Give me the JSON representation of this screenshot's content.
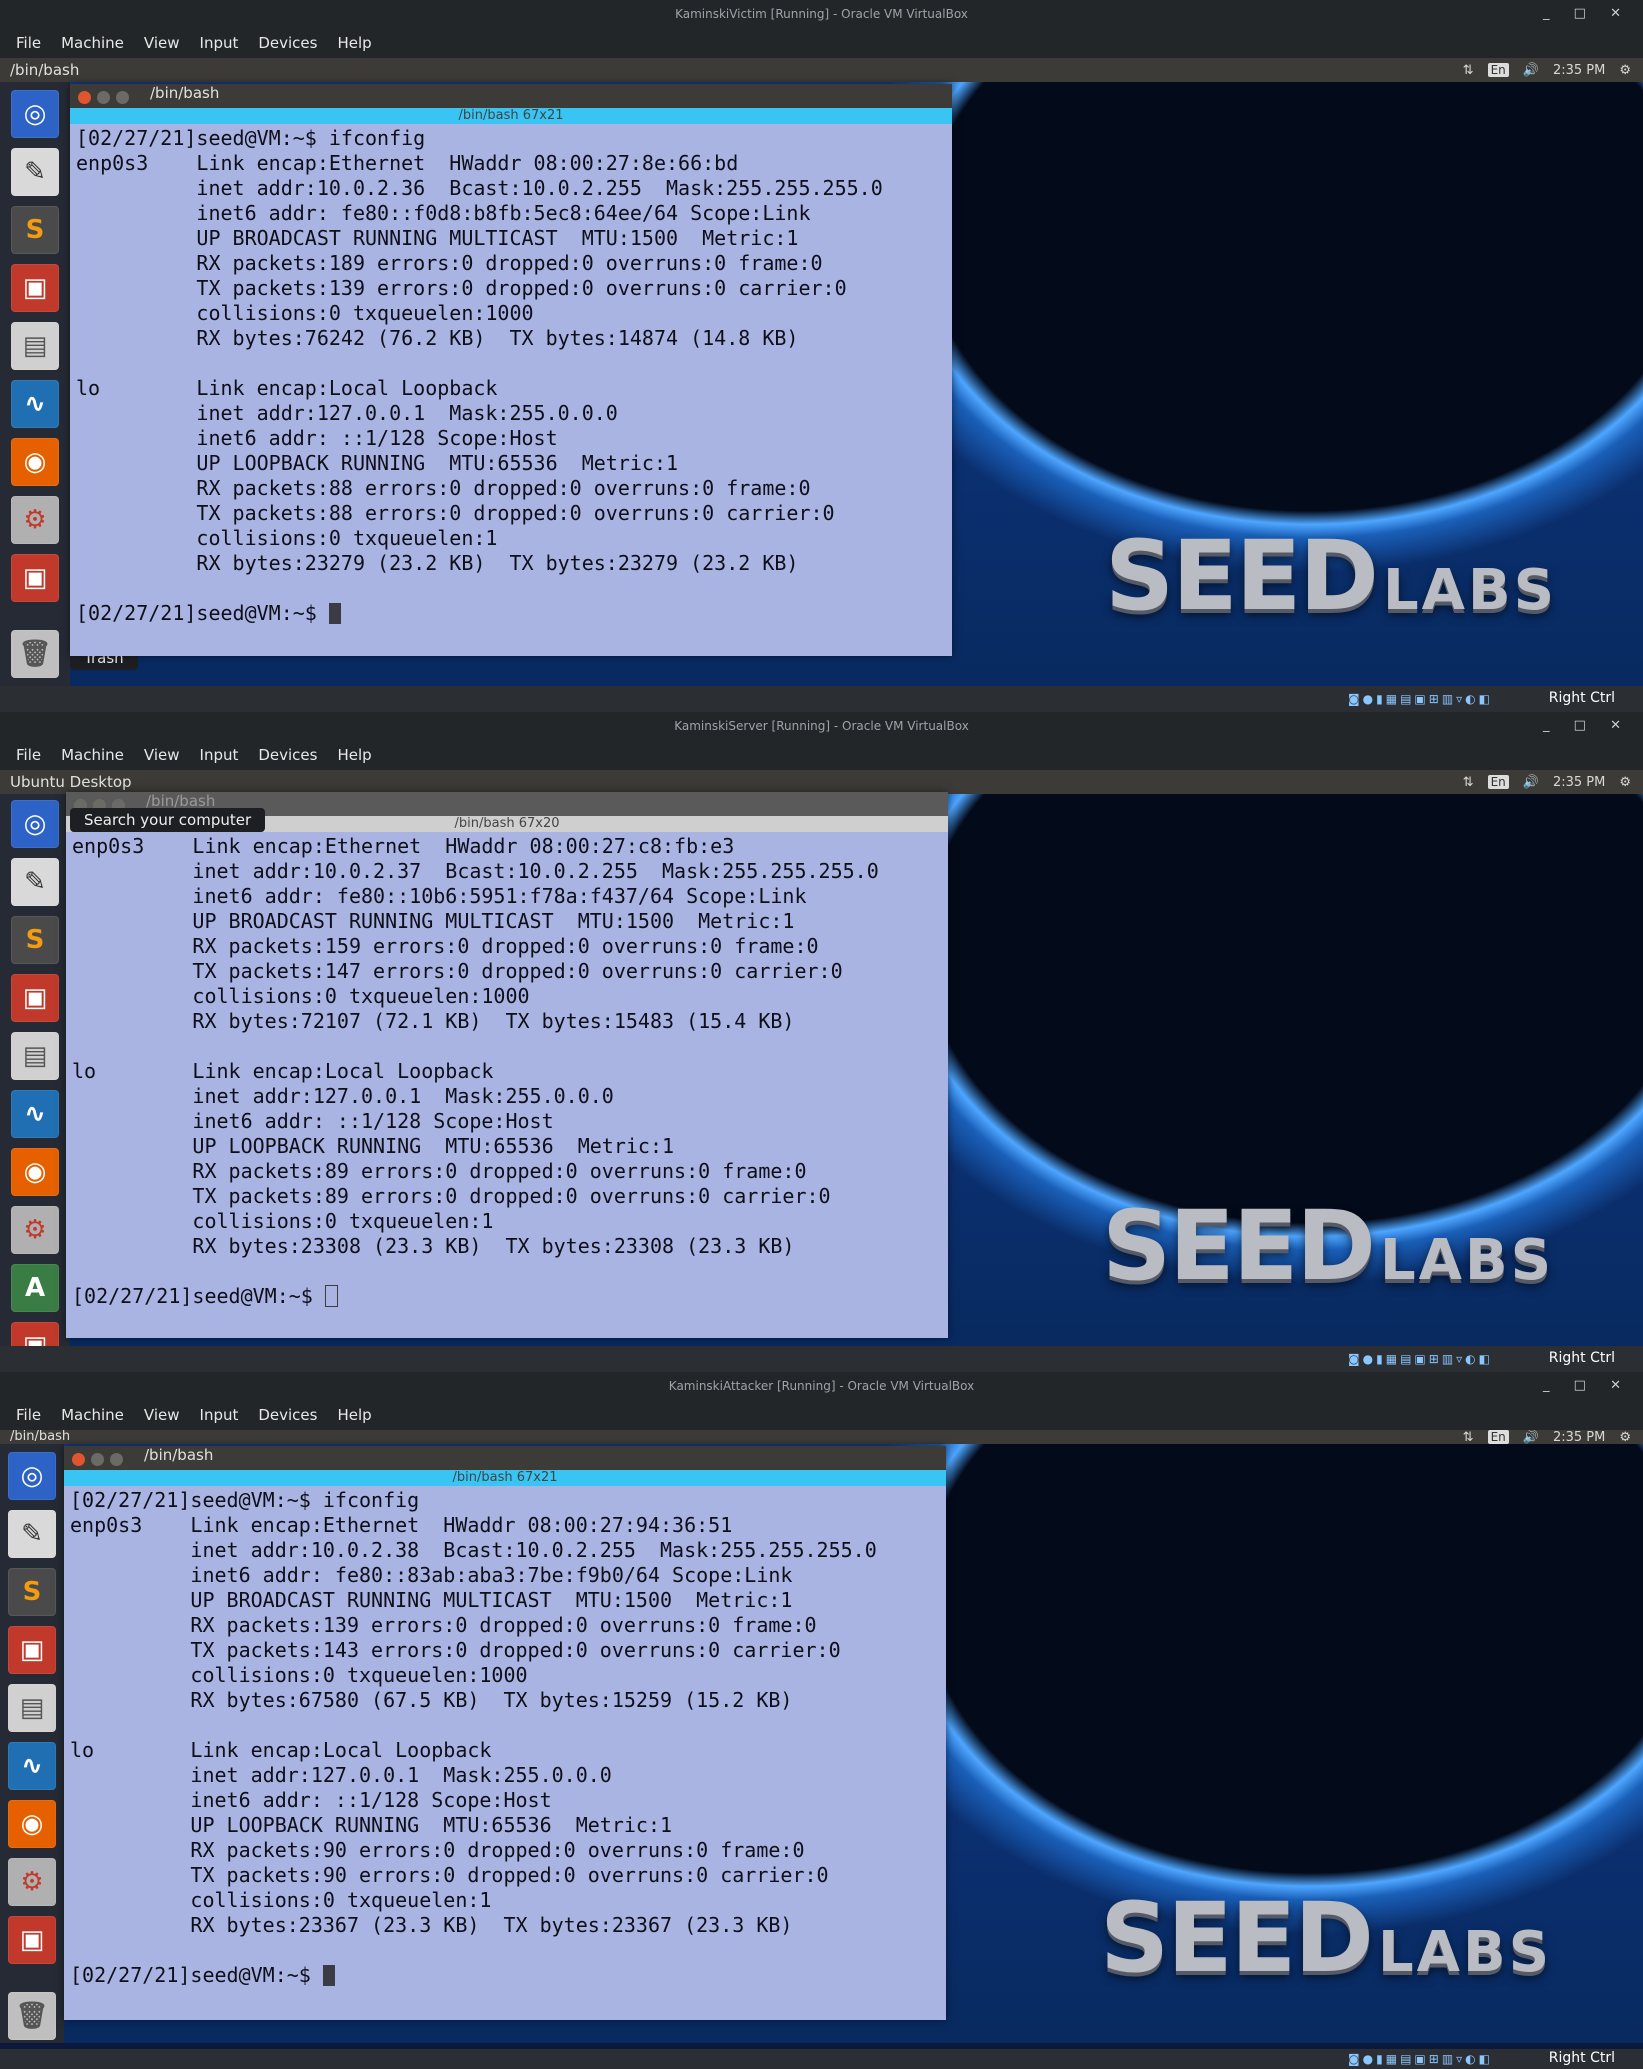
{
  "menu": [
    "File",
    "Machine",
    "View",
    "Input",
    "Devices",
    "Help"
  ],
  "host_key": "Right Ctrl",
  "logo": {
    "big": "SEED",
    "small": "LABS"
  },
  "lang": "En",
  "vms": [
    {
      "window_title": "KaminskiVictim [Running] - Oracle VM VirtualBox",
      "topbar_title": "/bin/bash",
      "clock": "2:35 PM",
      "term_title": "/bin/bash",
      "term_tab": "/bin/bash 67x21",
      "tooltip": "Trash",
      "lines": [
        "[02/27/21]seed@VM:~$ ifconfig",
        "enp0s3    Link encap:Ethernet  HWaddr 08:00:27:8e:66:bd",
        "          inet addr:10.0.2.36  Bcast:10.0.2.255  Mask:255.255.255.0",
        "          inet6 addr: fe80::f0d8:b8fb:5ec8:64ee/64 Scope:Link",
        "          UP BROADCAST RUNNING MULTICAST  MTU:1500  Metric:1",
        "          RX packets:189 errors:0 dropped:0 overruns:0 frame:0",
        "          TX packets:139 errors:0 dropped:0 overruns:0 carrier:0",
        "          collisions:0 txqueuelen:1000",
        "          RX bytes:76242 (76.2 KB)  TX bytes:14874 (14.8 KB)",
        "",
        "lo        Link encap:Local Loopback",
        "          inet addr:127.0.0.1  Mask:255.0.0.0",
        "          inet6 addr: ::1/128 Scope:Host",
        "          UP LOOPBACK RUNNING  MTU:65536  Metric:1",
        "          RX packets:88 errors:0 dropped:0 overruns:0 frame:0",
        "          TX packets:88 errors:0 dropped:0 overruns:0 carrier:0",
        "          collisions:0 txqueuelen:1",
        "          RX bytes:23279 (23.2 KB)  TX bytes:23279 (23.2 KB)",
        ""
      ],
      "prompt": "[02/27/21]seed@VM:~$ "
    },
    {
      "window_title": "KaminskiServer [Running] - Oracle VM VirtualBox",
      "topbar_title": "Ubuntu Desktop",
      "clock": "2:35 PM",
      "term_title": "/bin/bash",
      "term_tab": "/bin/bash 67x20",
      "tooltip": "Search your computer",
      "lines": [
        "enp0s3    Link encap:Ethernet  HWaddr 08:00:27:c8:fb:e3",
        "          inet addr:10.0.2.37  Bcast:10.0.2.255  Mask:255.255.255.0",
        "          inet6 addr: fe80::10b6:5951:f78a:f437/64 Scope:Link",
        "          UP BROADCAST RUNNING MULTICAST  MTU:1500  Metric:1",
        "          RX packets:159 errors:0 dropped:0 overruns:0 frame:0",
        "          TX packets:147 errors:0 dropped:0 overruns:0 carrier:0",
        "          collisions:0 txqueuelen:1000",
        "          RX bytes:72107 (72.1 KB)  TX bytes:15483 (15.4 KB)",
        "",
        "lo        Link encap:Local Loopback",
        "          inet addr:127.0.0.1  Mask:255.0.0.0",
        "          inet6 addr: ::1/128 Scope:Host",
        "          UP LOOPBACK RUNNING  MTU:65536  Metric:1",
        "          RX packets:89 errors:0 dropped:0 overruns:0 frame:0",
        "          TX packets:89 errors:0 dropped:0 overruns:0 carrier:0",
        "          collisions:0 txqueuelen:1",
        "          RX bytes:23308 (23.3 KB)  TX bytes:23308 (23.3 KB)",
        ""
      ],
      "prompt": "[02/27/21]seed@VM:~$ "
    },
    {
      "window_title": "KaminskiAttacker [Running] - Oracle VM VirtualBox",
      "topbar_title": "/bin/bash",
      "clock": "2:35 PM",
      "term_title": "/bin/bash",
      "term_tab": "/bin/bash 67x21",
      "tooltip": "",
      "lines": [
        "[02/27/21]seed@VM:~$ ifconfig",
        "enp0s3    Link encap:Ethernet  HWaddr 08:00:27:94:36:51",
        "          inet addr:10.0.2.38  Bcast:10.0.2.255  Mask:255.255.255.0",
        "          inet6 addr: fe80::83ab:aba3:7be:f9b0/64 Scope:Link",
        "          UP BROADCAST RUNNING MULTICAST  MTU:1500  Metric:1",
        "          RX packets:139 errors:0 dropped:0 overruns:0 frame:0",
        "          TX packets:143 errors:0 dropped:0 overruns:0 carrier:0",
        "          collisions:0 txqueuelen:1000",
        "          RX bytes:67580 (67.5 KB)  TX bytes:15259 (15.2 KB)",
        "",
        "lo        Link encap:Local Loopback",
        "          inet addr:127.0.0.1  Mask:255.0.0.0",
        "          inet6 addr: ::1/128 Scope:Host",
        "          UP LOOPBACK RUNNING  MTU:65536  Metric:1",
        "          RX packets:90 errors:0 dropped:0 overruns:0 frame:0",
        "          TX packets:90 errors:0 dropped:0 overruns:0 carrier:0",
        "          collisions:0 txqueuelen:1",
        "          RX bytes:23367 (23.3 KB)  TX bytes:23367 (23.3 KB)",
        ""
      ],
      "prompt": "[02/27/21]seed@VM:~$ "
    }
  ],
  "launcher_icons": [
    "dash-icon",
    "text-editor-icon",
    "sublime-text-icon",
    "terminal-icon",
    "file-manager-icon",
    "wireshark-icon",
    "firefox-icon",
    "settings-icon",
    "terminal-icon",
    "trash-icon"
  ]
}
